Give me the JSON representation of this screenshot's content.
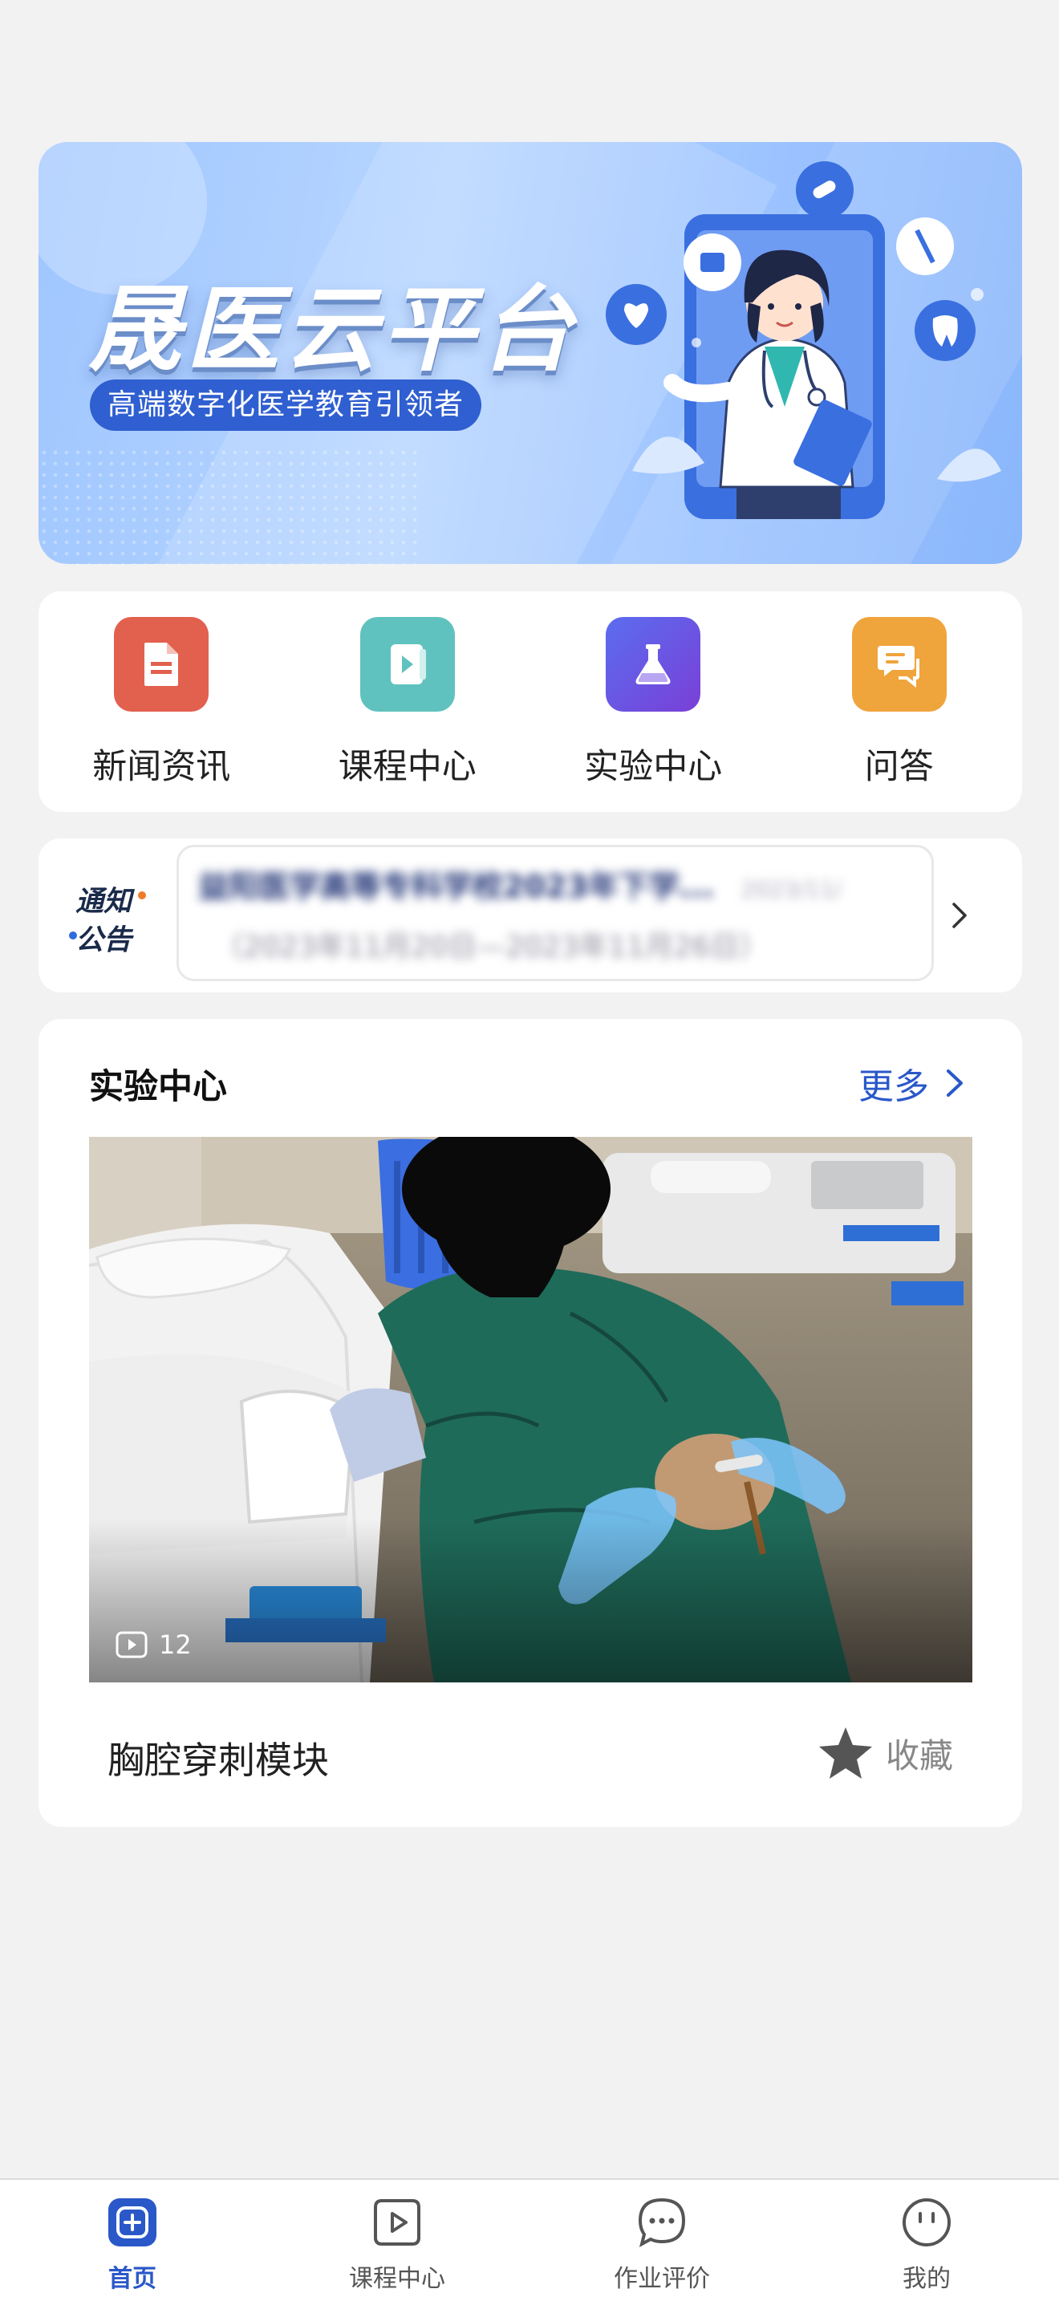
{
  "banner": {
    "title": "晟医云平台",
    "subtitle": "高端数字化医学教育引领者"
  },
  "menu": {
    "items": [
      {
        "label": "新闻资讯",
        "icon": "document-icon",
        "color": "#e2604e"
      },
      {
        "label": "课程中心",
        "icon": "video-icon",
        "color": "#5fc2be"
      },
      {
        "label": "实验中心",
        "icon": "flask-icon",
        "color": "#6b4fe0"
      },
      {
        "label": "问答",
        "icon": "chat-icon",
        "color": "#f0a43c"
      }
    ]
  },
  "notice": {
    "logo_line1": "通知",
    "logo_line2": "公告",
    "title": "益阳医学高等专科学校2023年下学...",
    "date": "2023/11/",
    "dates_range": "（2023年11月20日—2023年11月26日）"
  },
  "lab": {
    "section_title": "实验中心",
    "more_label": "更多",
    "play_count": "12",
    "course_name": "胸腔穿刺模块",
    "favorite_label": "收藏"
  },
  "tabbar": {
    "items": [
      {
        "label": "首页",
        "icon": "home-icon",
        "active": true
      },
      {
        "label": "课程中心",
        "icon": "play-icon",
        "active": false
      },
      {
        "label": "作业评价",
        "icon": "comment-icon",
        "active": false
      },
      {
        "label": "我的",
        "icon": "profile-icon",
        "active": false
      }
    ]
  },
  "colors": {
    "accent": "#2a58c9",
    "background": "#f2f2f2"
  }
}
